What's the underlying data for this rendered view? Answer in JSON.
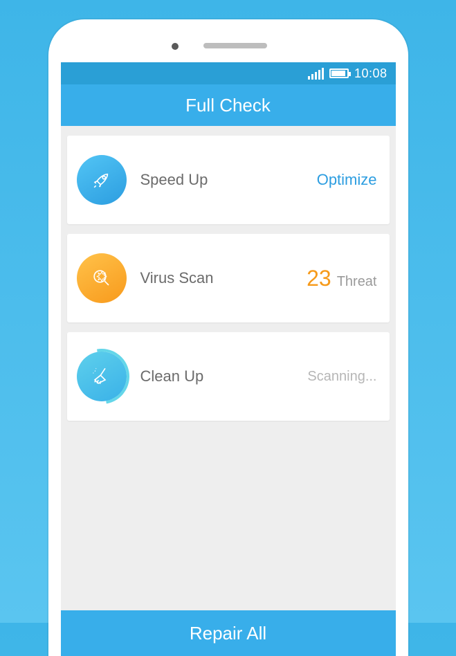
{
  "status": {
    "time": "10:08"
  },
  "header": {
    "title": "Full Check"
  },
  "cards": {
    "speedup": {
      "title": "Speed Up",
      "action": "Optimize"
    },
    "virus": {
      "title": "Virus Scan",
      "count": "23",
      "threat_label": "Threat"
    },
    "cleanup": {
      "title": "Clean Up",
      "status": "Scanning..."
    }
  },
  "footer": {
    "button": "Repair All"
  }
}
